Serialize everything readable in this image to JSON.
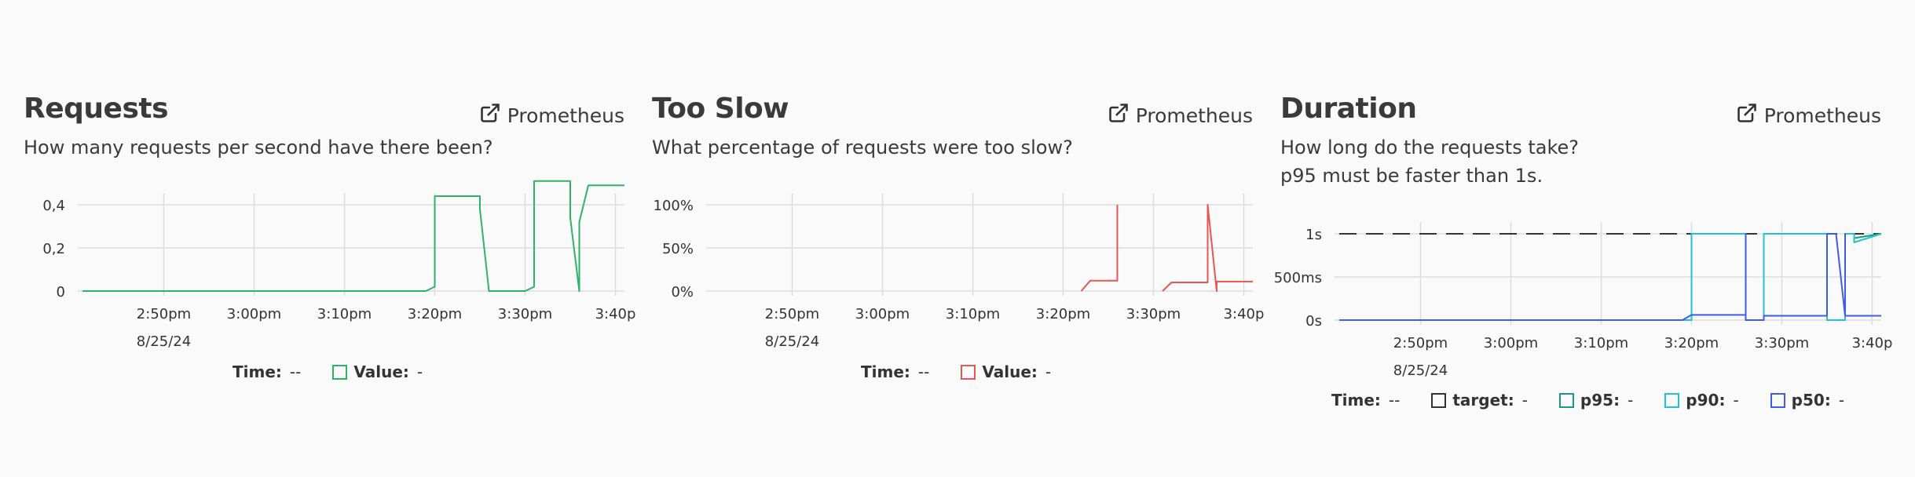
{
  "panels": [
    {
      "title": "Requests",
      "description": [
        "How many requests per second have there been?"
      ],
      "link_label": "Prometheus",
      "legend": {
        "time_label": "Time:",
        "time_value": "--",
        "items": [
          {
            "label": "Value:",
            "value": "-",
            "color": "#2fb36b"
          }
        ]
      }
    },
    {
      "title": "Too Slow",
      "description": [
        "What percentage of requests were too slow?"
      ],
      "link_label": "Prometheus",
      "legend": {
        "time_label": "Time:",
        "time_value": "--",
        "items": [
          {
            "label": "Value:",
            "value": "-",
            "color": "#e85555"
          }
        ]
      }
    },
    {
      "title": "Duration",
      "description": [
        "How long do the requests take?",
        "p95 must be faster than 1s."
      ],
      "link_label": "Prometheus",
      "legend": {
        "time_label": "Time:",
        "time_value": "--",
        "items": [
          {
            "label": "target:",
            "value": "-",
            "color": "#333333"
          },
          {
            "label": "p95:",
            "value": "-",
            "color": "#19998a"
          },
          {
            "label": "p90:",
            "value": "-",
            "color": "#22c3d0"
          },
          {
            "label": "p50:",
            "value": "-",
            "color": "#3d5ce8"
          }
        ]
      }
    }
  ],
  "chart_data": [
    {
      "type": "line",
      "x_ticks": [
        "2:50pm",
        "3:00pm",
        "3:10pm",
        "3:20pm",
        "3:30pm",
        "3:40p"
      ],
      "x_date_label": "8/25/24",
      "x_range": [
        "2:41pm",
        "3:41pm"
      ],
      "y_ticks": [
        "0",
        "0,2",
        "0,4"
      ],
      "ylim": [
        0,
        0.4
      ],
      "grid": true,
      "series": [
        {
          "color": "#2fb36b",
          "x": [
            "2:41pm",
            "3:19pm",
            "3:20pm",
            "3:20pm",
            "3:25pm",
            "3:25pm",
            "3:26pm",
            "3:30pm",
            "3:31pm",
            "3:31pm",
            "3:35pm",
            "3:35pm",
            "3:36pm",
            "3:36pm",
            "3:37pm",
            "3:41pm"
          ],
          "y": [
            0,
            0,
            0.02,
            0.44,
            0.44,
            0.38,
            0,
            0,
            0.02,
            0.51,
            0.51,
            0.34,
            0,
            0.32,
            0.49,
            0.49
          ]
        }
      ]
    },
    {
      "type": "line",
      "x_ticks": [
        "2:50pm",
        "3:00pm",
        "3:10pm",
        "3:20pm",
        "3:30pm",
        "3:40p"
      ],
      "x_date_label": "8/25/24",
      "x_range": [
        "2:41pm",
        "3:41pm"
      ],
      "y_ticks": [
        "0%",
        "50%",
        "100%"
      ],
      "ylim": [
        0,
        100
      ],
      "grid": true,
      "series": [
        {
          "color": "#e85555",
          "segments": [
            {
              "x": [
                "3:22pm",
                "3:23pm",
                "3:26pm",
                "3:26pm"
              ],
              "y": [
                0,
                12,
                12,
                100
              ]
            },
            {
              "x": [
                "3:31pm",
                "3:32pm",
                "3:36pm",
                "3:36pm",
                "3:37pm",
                "3:37pm",
                "3:41pm"
              ],
              "y": [
                0,
                10,
                10,
                100,
                0,
                11,
                11
              ]
            }
          ]
        }
      ]
    },
    {
      "type": "line",
      "x_ticks": [
        "2:50pm",
        "3:00pm",
        "3:10pm",
        "3:20pm",
        "3:30pm",
        "3:40p"
      ],
      "x_date_label": "8/25/24",
      "x_range": [
        "2:41pm",
        "3:41pm"
      ],
      "y_ticks": [
        "0s",
        "500ms",
        "1s"
      ],
      "ylim": [
        0,
        1
      ],
      "grid": true,
      "series": [
        {
          "name": "target",
          "color": "#333333",
          "dashed": true,
          "x": [
            "2:41pm",
            "3:41pm"
          ],
          "y": [
            1,
            1
          ]
        },
        {
          "name": "p95",
          "color": "#19998a",
          "x": [
            "2:41pm",
            "3:20pm",
            "3:20pm",
            "3:26pm",
            "3:26pm",
            "3:28pm",
            "3:28pm",
            "3:35pm",
            "3:35pm",
            "3:37pm",
            "3:37pm",
            "3:38pm",
            "3:38pm",
            "3:41pm"
          ],
          "y": [
            0,
            0,
            1,
            1,
            0,
            0,
            1,
            1,
            0,
            0,
            1,
            1,
            0.95,
            1
          ]
        },
        {
          "name": "p90",
          "color": "#22c3d0",
          "x": [
            "2:41pm",
            "3:20pm",
            "3:20pm",
            "3:26pm",
            "3:26pm",
            "3:28pm",
            "3:28pm",
            "3:35pm",
            "3:35pm",
            "3:37pm",
            "3:37pm",
            "3:38pm",
            "3:38pm",
            "3:41pm"
          ],
          "y": [
            0,
            0,
            1,
            1,
            0,
            0,
            1,
            1,
            0,
            0,
            1,
            1,
            0.9,
            1
          ]
        },
        {
          "name": "p50",
          "color": "#3d5ce8",
          "x": [
            "2:41pm",
            "3:19pm",
            "3:20pm",
            "3:26pm",
            "3:26pm",
            "3:26pm",
            "3:26pm",
            "3:28pm",
            "3:28pm",
            "3:35pm",
            "3:35pm",
            "3:36pm",
            "3:37pm",
            "3:37pm",
            "3:37pm",
            "3:41pm"
          ],
          "y": [
            0,
            0,
            0.06,
            0.06,
            1,
            1,
            0,
            0,
            0.05,
            0.05,
            1,
            1,
            0.05,
            1,
            0.05,
            0.05
          ]
        }
      ]
    }
  ]
}
